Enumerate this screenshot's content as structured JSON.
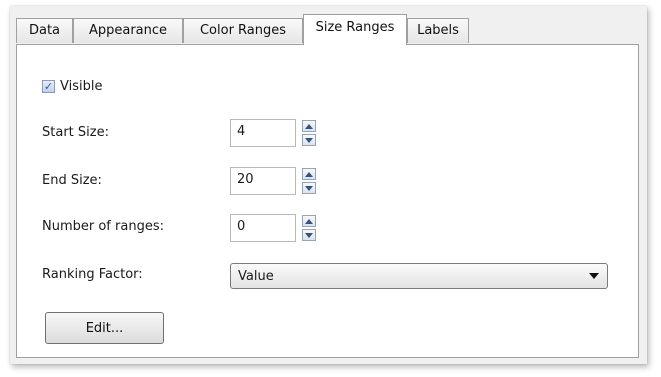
{
  "tabs": [
    {
      "label": "Data",
      "active": false
    },
    {
      "label": "Appearance",
      "active": false
    },
    {
      "label": "Color Ranges",
      "active": false
    },
    {
      "label": "Size Ranges",
      "active": true
    },
    {
      "label": "Labels",
      "active": false
    }
  ],
  "visible": {
    "label": "Visible",
    "checked": true
  },
  "start_size": {
    "label": "Start Size:",
    "value": "4"
  },
  "end_size": {
    "label": "End Size:",
    "value": "20"
  },
  "number_of_ranges": {
    "label": "Number of ranges:",
    "value": "0"
  },
  "ranking_factor": {
    "label": "Ranking Factor:",
    "value": "Value"
  },
  "edit_button": {
    "label": "Edit..."
  }
}
